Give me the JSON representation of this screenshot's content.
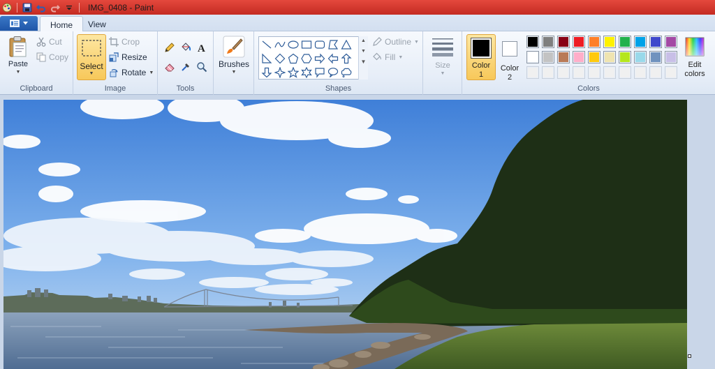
{
  "window": {
    "title": "IMG_0408 - Paint"
  },
  "tabs": [
    {
      "label": "Home",
      "active": true
    },
    {
      "label": "View",
      "active": false
    }
  ],
  "clipboard": {
    "paste": "Paste",
    "cut": "Cut",
    "copy": "Copy",
    "label": "Clipboard"
  },
  "image": {
    "select": "Select",
    "crop": "Crop",
    "resize": "Resize",
    "rotate": "Rotate",
    "label": "Image"
  },
  "tools": {
    "label": "Tools",
    "items": [
      "pencil-icon",
      "fill-bucket-icon",
      "text-icon",
      "eraser-icon",
      "color-picker-icon",
      "magnifier-icon"
    ]
  },
  "brushes": {
    "label": "Brushes"
  },
  "shapes": {
    "label": "Shapes",
    "outline": "Outline",
    "fill": "Fill"
  },
  "size": {
    "label": "Size"
  },
  "colors": {
    "color1_line1": "Color",
    "color1_line2": "1",
    "color2_line1": "Color",
    "color2_line2": "2",
    "edit_line1": "Edit",
    "edit_line2": "colors",
    "label": "Colors",
    "color1": "#000000",
    "color2": "#ffffff",
    "palette": [
      [
        "#000000",
        "#7f7f7f",
        "#880015",
        "#ed1c24",
        "#ff7f27",
        "#fff200",
        "#22b14c",
        "#00a2e8",
        "#3f48cc",
        "#a349a4"
      ],
      [
        "#ffffff",
        "#c3c3c3",
        "#b97a57",
        "#ffaec9",
        "#ffc90e",
        "#efe4b0",
        "#b5e61d",
        "#99d9ea",
        "#7092be",
        "#c8bfe7"
      ],
      [
        "#f0f0f0",
        "#f0f0f0",
        "#f0f0f0",
        "#f0f0f0",
        "#f0f0f0",
        "#f0f0f0",
        "#f0f0f0",
        "#f0f0f0",
        "#f0f0f0",
        "#f0f0f0"
      ]
    ]
  }
}
